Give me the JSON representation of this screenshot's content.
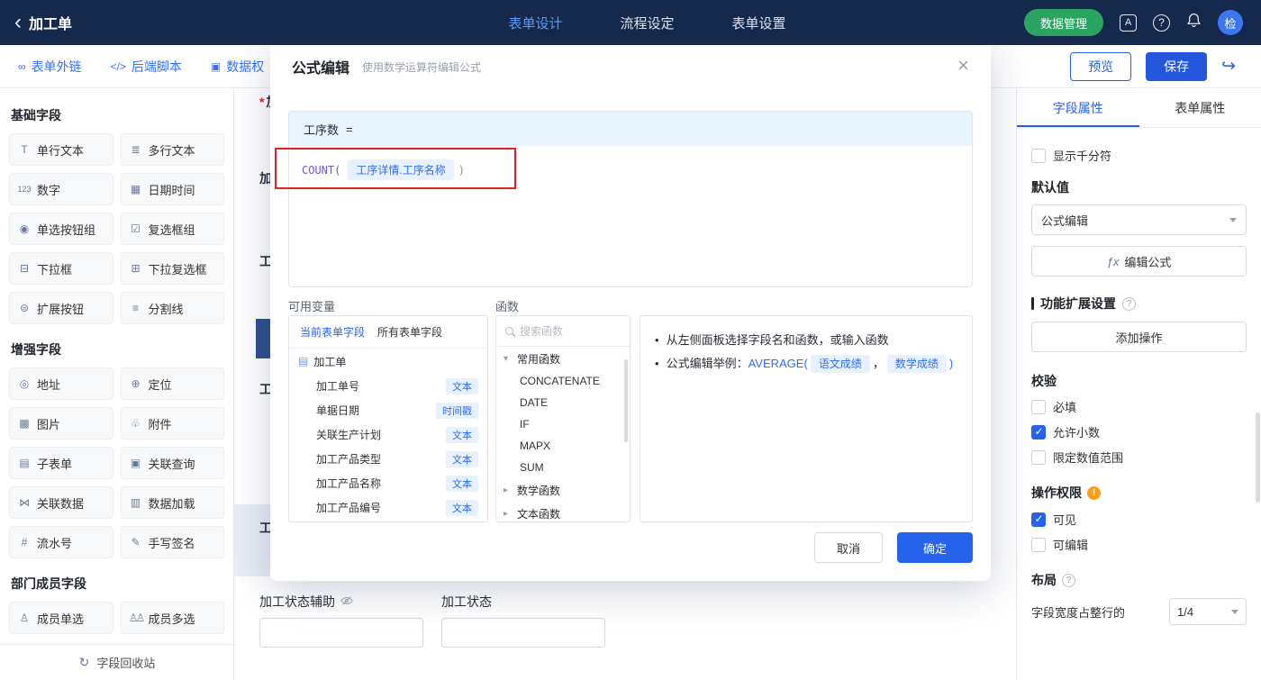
{
  "colors": {
    "accent": "#2563eb",
    "topbar_bg": "#15294d",
    "green_button": "#2aa561",
    "annotation_red": "#e02321",
    "tag_bg": "#e8f1ff",
    "tag_text": "#2f6bff"
  },
  "topbar": {
    "title": "加工单",
    "tabs": [
      {
        "label": "表单设计",
        "active": true
      },
      {
        "label": "流程设定",
        "active": false
      },
      {
        "label": "表单设置",
        "active": false
      }
    ],
    "data_manage": "数据管理",
    "avatar": "检"
  },
  "toolbar": {
    "links": [
      {
        "label": "表单外链",
        "icon": "∞"
      },
      {
        "label": "后端脚本",
        "icon": "</>"
      },
      {
        "label": "数据权",
        "icon": "▣"
      }
    ],
    "preview": "预览",
    "save": "保存"
  },
  "sidebar": {
    "sections": [
      {
        "title": "基础字段",
        "items": [
          {
            "label": "单行文本",
            "icon": "T"
          },
          {
            "label": "多行文本",
            "icon": "≣"
          },
          {
            "label": "数字",
            "icon": "123"
          },
          {
            "label": "日期时间",
            "icon": "▦"
          },
          {
            "label": "单选按钮组",
            "icon": "◉"
          },
          {
            "label": "复选框组",
            "icon": "☑"
          },
          {
            "label": "下拉框",
            "icon": "⊟"
          },
          {
            "label": "下拉复选框",
            "icon": "⊞"
          },
          {
            "label": "扩展按钮",
            "icon": "⊜"
          },
          {
            "label": "分割线",
            "icon": "≡"
          }
        ]
      },
      {
        "title": "增强字段",
        "items": [
          {
            "label": "地址",
            "icon": "◎"
          },
          {
            "label": "定位",
            "icon": "⊕"
          },
          {
            "label": "图片",
            "icon": "▩"
          },
          {
            "label": "附件",
            "icon": "♧"
          },
          {
            "label": "子表单",
            "icon": "▤"
          },
          {
            "label": "关联查询",
            "icon": "▣"
          },
          {
            "label": "关联数据",
            "icon": "⋈"
          },
          {
            "label": "数据加载",
            "icon": "▥"
          },
          {
            "label": "流水号",
            "icon": "#"
          },
          {
            "label": "手写签名",
            "icon": "✎"
          }
        ]
      },
      {
        "title": "部门成员字段",
        "items": [
          {
            "label": "成员单选",
            "icon": "♙"
          },
          {
            "label": "成员多选",
            "icon": "♙♙"
          }
        ]
      }
    ],
    "recycle": "字段回收站"
  },
  "canvas": {
    "fragments": [
      {
        "text": "加",
        "required": true
      },
      {
        "text": "加",
        "required": false
      },
      {
        "text": "工",
        "required": false
      },
      {
        "text": "工",
        "required": false
      },
      {
        "text": "工",
        "required": false
      }
    ],
    "fields": [
      {
        "label": "加工状态辅助"
      },
      {
        "label": "加工状态"
      }
    ]
  },
  "modal": {
    "title": "公式编辑",
    "subtitle": "使用数学运算符编辑公式",
    "formula": {
      "target": "工序数",
      "equals": "=",
      "fn": "COUNT(",
      "variable": "工序详情.工序名称",
      "close": ")"
    },
    "variables": {
      "label": "可用变量",
      "tabs": [
        {
          "label": "当前表单字段",
          "active": true
        },
        {
          "label": "所有表单字段",
          "active": false
        }
      ],
      "root": "加工单",
      "rows": [
        {
          "name": "加工单号",
          "type": "文本"
        },
        {
          "name": "单据日期",
          "type": "时间戳"
        },
        {
          "name": "关联生产计划",
          "type": "文本"
        },
        {
          "name": "加工产品类型",
          "type": "文本"
        },
        {
          "name": "加工产品名称",
          "type": "文本"
        },
        {
          "name": "加工产品编号",
          "type": "文本"
        }
      ]
    },
    "functions": {
      "label": "函数",
      "search_placeholder": "搜索函数",
      "groups": [
        {
          "name": "常用函数",
          "expanded": true
        },
        {
          "name": "数学函数",
          "expanded": false
        },
        {
          "name": "文本函数",
          "expanded": false
        }
      ],
      "common_items": [
        "CONCATENATE",
        "DATE",
        "IF",
        "MAPX",
        "SUM"
      ]
    },
    "tips": {
      "line1": "从左侧面板选择字段名和函数，或输入函数",
      "line2_label": "公式编辑举例：",
      "line2_fn": "AVERAGE(",
      "tag1": "语文成绩",
      "separator": "，",
      "tag2": "数学成绩",
      "line2_close": ")"
    },
    "cancel": "取消",
    "confirm": "确定"
  },
  "properties": {
    "tabs": [
      {
        "label": "字段属性",
        "active": true
      },
      {
        "label": "表单属性",
        "active": false
      }
    ],
    "thousands": {
      "label": "显示千分符",
      "checked": false
    },
    "default_value": {
      "label": "默认值",
      "selected": "公式编辑",
      "fx": "ƒx",
      "edit_button": "编辑公式"
    },
    "extension": {
      "title": "功能扩展设置",
      "button": "添加操作"
    },
    "validation": {
      "title": "校验",
      "items": [
        {
          "label": "必填",
          "checked": false
        },
        {
          "label": "允许小数",
          "checked": true
        },
        {
          "label": "限定数值范围",
          "checked": false
        }
      ]
    },
    "permission": {
      "title": "操作权限",
      "items": [
        {
          "label": "可见",
          "checked": true
        },
        {
          "label": "可编辑",
          "checked": false
        }
      ]
    },
    "layout": {
      "title": "布局",
      "width_label": "字段宽度占整行的",
      "width_value": "1/4"
    }
  }
}
